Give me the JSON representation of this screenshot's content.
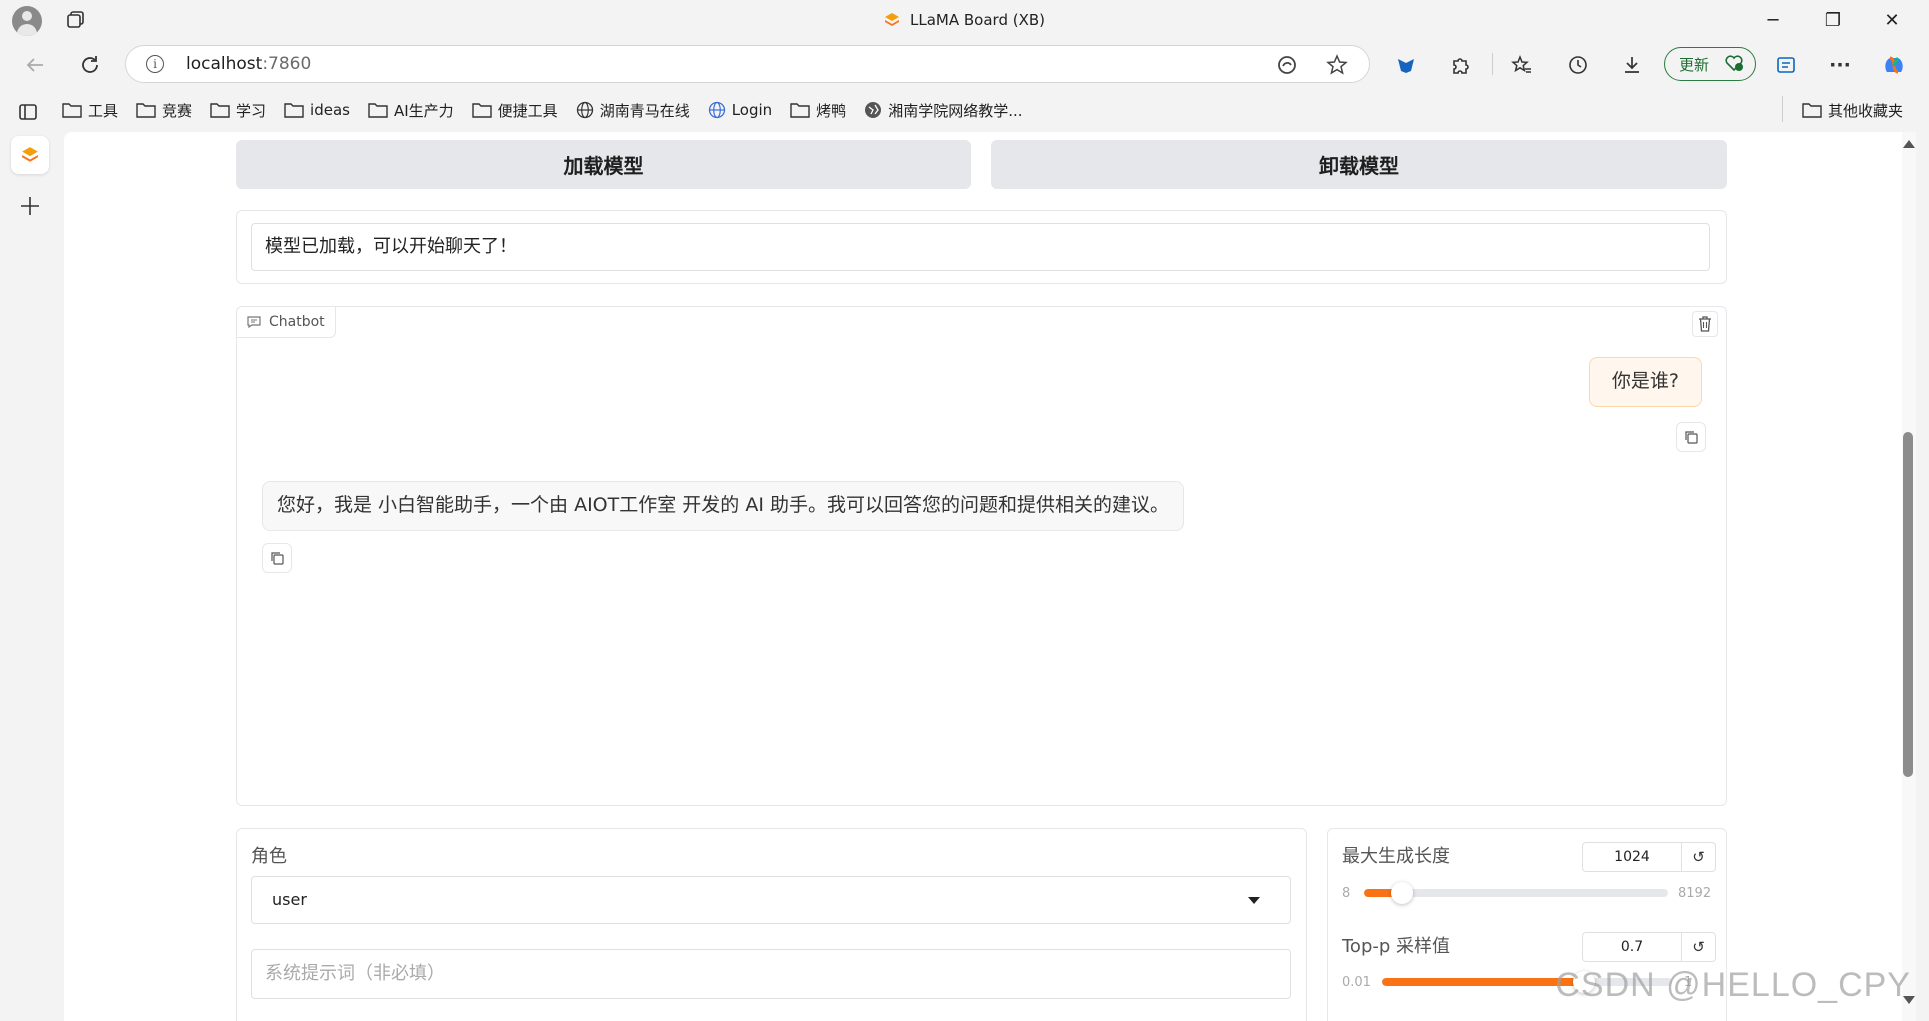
{
  "window": {
    "title": "LLaMA Board (XB)",
    "minimize": "─",
    "maximize": "❐",
    "close": "✕"
  },
  "address": {
    "host": "localhost",
    "port": ":7860"
  },
  "toolbar": {
    "update_label": "更新"
  },
  "favorites": {
    "items": [
      {
        "label": "工具",
        "icon": "folder-icon"
      },
      {
        "label": "竞赛",
        "icon": "folder-icon"
      },
      {
        "label": "学习",
        "icon": "folder-icon"
      },
      {
        "label": "ideas",
        "icon": "folder-icon"
      },
      {
        "label": "AI生产力",
        "icon": "folder-icon"
      },
      {
        "label": "便捷工具",
        "icon": "folder-icon"
      },
      {
        "label": "湖南青马在线",
        "icon": "globe-icon"
      },
      {
        "label": "Login",
        "icon": "globe-icon"
      },
      {
        "label": "烤鸭",
        "icon": "folder-icon"
      },
      {
        "label": "湘南学院网络教学...",
        "icon": "globe-icon"
      }
    ],
    "other": "其他收藏夹"
  },
  "actions": {
    "load_model": "加载模型",
    "unload_model": "卸载模型"
  },
  "status": {
    "text": "模型已加载，可以开始聊天了！"
  },
  "chatbot": {
    "label": "Chatbot",
    "messages": [
      {
        "role": "user",
        "text": "你是谁?"
      },
      {
        "role": "assistant",
        "text": "您好，我是 小白智能助手，一个由 AIOT工作室 开发的 AI 助手。我可以回答您的问题和提供相关的建议。"
      }
    ]
  },
  "role": {
    "label": "角色",
    "value": "user"
  },
  "system_prompt": {
    "placeholder": "系统提示词（非必填）"
  },
  "params": {
    "max_new_tokens": {
      "label": "最大生成长度",
      "value": "1024",
      "min": "8",
      "max": "8192",
      "fraction": 0.124
    },
    "top_p": {
      "label": "Top-p 采样值",
      "value": "0.7",
      "min": "0.01",
      "max": "1",
      "fraction": 0.697
    }
  },
  "watermark": "CSDN @HELLO_CPY",
  "colors": {
    "accent": "#f97316",
    "user_bubble": "#fff7ed",
    "button_bg": "#e5e7eb"
  }
}
